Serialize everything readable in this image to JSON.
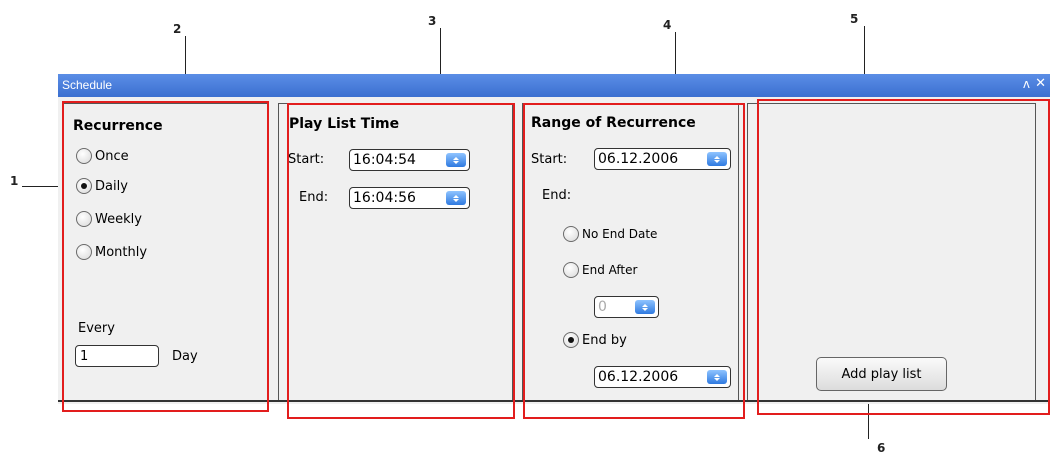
{
  "window": {
    "title": "Schedule",
    "pin_glyph": "ᴧ",
    "close_glyph": "✕"
  },
  "callouts": [
    "1",
    "2",
    "3",
    "4",
    "5",
    "6"
  ],
  "recurrence": {
    "heading": "Recurrence",
    "options": [
      "Once",
      "Daily",
      "Weekly",
      "Monthly"
    ],
    "selected": "Daily",
    "every_label": "Every",
    "every_value": "1",
    "unit_label": "Day"
  },
  "playlist_time": {
    "heading": "Play List Time",
    "start_label": "Start:",
    "start_value": "16:04:54",
    "end_label": "End:",
    "end_value": "16:04:56"
  },
  "range": {
    "heading": "Range of Recurrence",
    "start_label": "Start:",
    "start_value": "06.12.2006",
    "end_label": "End:",
    "no_end_label": "No End Date",
    "end_after_label": "End After",
    "end_after_value": "0",
    "end_by_label": "End by",
    "end_by_value": "06.12.2006",
    "selected": "End by"
  },
  "actions": {
    "add_playlist_label": "Add play list"
  },
  "colors": {
    "titlebar": "#3b6fd0",
    "highlight": "#e21d1d",
    "spin_button": "#2f7ae0"
  }
}
